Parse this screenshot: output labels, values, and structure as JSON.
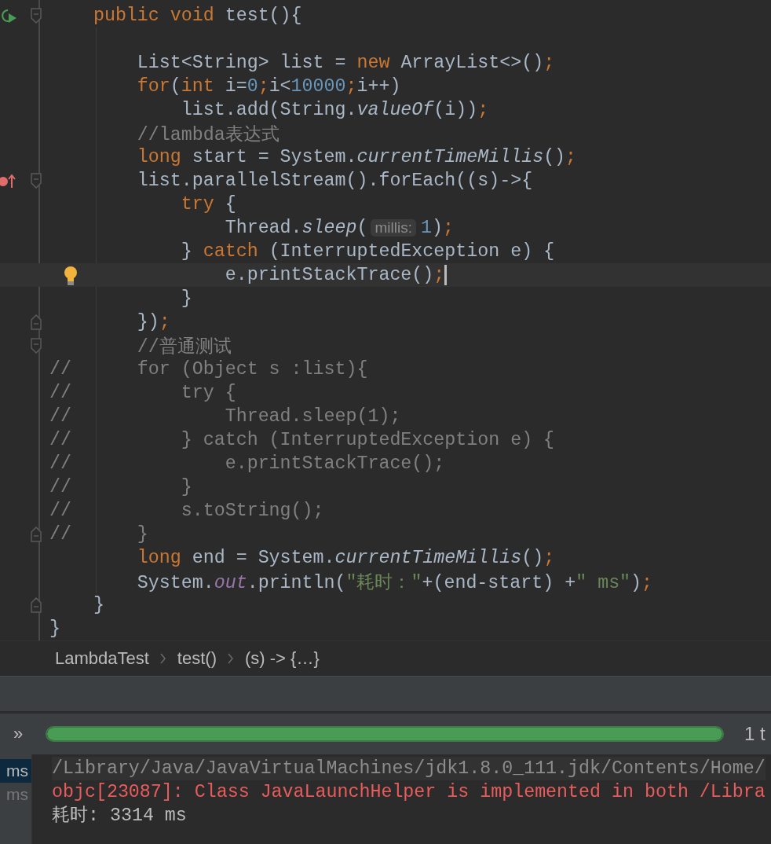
{
  "editor": {
    "lines": [
      {
        "run_marker": true,
        "fold_start": true,
        "blank_after": true,
        "tokens": [
          {
            "text": "    public void ",
            "kind": "keyword"
          },
          {
            "text": "test(){",
            "kind": "plain"
          }
        ]
      },
      {
        "tokens": [
          {
            "text": "        List<String> list = ",
            "kind": "plain"
          },
          {
            "text": "new ",
            "kind": "keyword"
          },
          {
            "text": "ArrayList<>()",
            "kind": "plain"
          },
          {
            "text": ";",
            "kind": "keyword"
          }
        ]
      },
      {
        "tokens": [
          {
            "text": "        for",
            "kind": "keyword"
          },
          {
            "text": "(",
            "kind": "plain"
          },
          {
            "text": "int ",
            "kind": "keyword"
          },
          {
            "text": "i=",
            "kind": "plain"
          },
          {
            "text": "0",
            "kind": "number"
          },
          {
            "text": ";",
            "kind": "keyword"
          },
          {
            "text": "i<",
            "kind": "plain"
          },
          {
            "text": "10000",
            "kind": "number"
          },
          {
            "text": ";",
            "kind": "keyword"
          },
          {
            "text": "i++)",
            "kind": "plain"
          }
        ]
      },
      {
        "tokens": [
          {
            "text": "            list.add(String.",
            "kind": "plain"
          },
          {
            "text": "valueOf",
            "kind": "method"
          },
          {
            "text": "(i))",
            "kind": "plain"
          },
          {
            "text": ";",
            "kind": "keyword"
          }
        ]
      },
      {
        "tokens": [
          {
            "text": "        //lambda表达式",
            "kind": "comment"
          }
        ]
      },
      {
        "tokens": [
          {
            "text": "        long ",
            "kind": "keyword"
          },
          {
            "text": "start = System.",
            "kind": "plain"
          },
          {
            "text": "currentTimeMillis",
            "kind": "method"
          },
          {
            "text": "()",
            "kind": "plain"
          },
          {
            "text": ";",
            "kind": "keyword"
          }
        ]
      },
      {
        "override_marker": true,
        "fold_start": true,
        "tokens": [
          {
            "text": "        list.parallelStream().forEach((s)->{",
            "kind": "plain"
          }
        ]
      },
      {
        "tokens": [
          {
            "text": "            try ",
            "kind": "keyword"
          },
          {
            "text": "{",
            "kind": "plain"
          }
        ]
      },
      {
        "tokens": [
          {
            "text": "                Thread.",
            "kind": "plain"
          },
          {
            "text": "sleep",
            "kind": "method"
          },
          {
            "text": "(",
            "kind": "plain"
          },
          {
            "text": "millis:",
            "kind": "hint"
          },
          {
            "text": "1",
            "kind": "number"
          },
          {
            "text": ")",
            "kind": "plain"
          },
          {
            "text": ";",
            "kind": "keyword"
          }
        ]
      },
      {
        "tokens": [
          {
            "text": "            } ",
            "kind": "plain"
          },
          {
            "text": "catch ",
            "kind": "keyword"
          },
          {
            "text": "(InterruptedException e) {",
            "kind": "plain"
          }
        ]
      },
      {
        "bulb": true,
        "current": true,
        "caret": true,
        "tokens": [
          {
            "text": "                e.printStackTrace()",
            "kind": "plain"
          },
          {
            "text": ";",
            "kind": "keyword"
          }
        ]
      },
      {
        "tokens": [
          {
            "text": "            }",
            "kind": "plain"
          }
        ]
      },
      {
        "fold_end": true,
        "tokens": [
          {
            "text": "        })",
            "kind": "plain"
          },
          {
            "text": ";",
            "kind": "keyword"
          }
        ]
      },
      {
        "fold_start": true,
        "tokens": [
          {
            "text": "        //普通测试",
            "kind": "comment"
          }
        ]
      },
      {
        "tokens": [
          {
            "text": "//      for (Object s :list){",
            "kind": "comment"
          }
        ]
      },
      {
        "tokens": [
          {
            "text": "//          try {",
            "kind": "comment"
          }
        ]
      },
      {
        "tokens": [
          {
            "text": "//              Thread.sleep(1);",
            "kind": "comment"
          }
        ]
      },
      {
        "tokens": [
          {
            "text": "//          } catch (InterruptedException e) {",
            "kind": "comment"
          }
        ]
      },
      {
        "tokens": [
          {
            "text": "//              e.printStackTrace();",
            "kind": "comment"
          }
        ]
      },
      {
        "tokens": [
          {
            "text": "//          }",
            "kind": "comment"
          }
        ]
      },
      {
        "tokens": [
          {
            "text": "//          s.toString();",
            "kind": "comment"
          }
        ]
      },
      {
        "fold_end": true,
        "tokens": [
          {
            "text": "//      }",
            "kind": "comment"
          }
        ]
      },
      {
        "tokens": [
          {
            "text": "        long ",
            "kind": "keyword"
          },
          {
            "text": "end = System.",
            "kind": "plain"
          },
          {
            "text": "currentTimeMillis",
            "kind": "method"
          },
          {
            "text": "()",
            "kind": "plain"
          },
          {
            "text": ";",
            "kind": "keyword"
          }
        ]
      },
      {
        "tokens": [
          {
            "text": "        System.",
            "kind": "plain"
          },
          {
            "text": "out",
            "kind": "field"
          },
          {
            "text": ".println(",
            "kind": "plain"
          },
          {
            "text": "\"耗时：\"",
            "kind": "string"
          },
          {
            "text": "+(end-start) +",
            "kind": "plain"
          },
          {
            "text": "\" ms\"",
            "kind": "string"
          },
          {
            "text": ")",
            "kind": "plain"
          },
          {
            "text": ";",
            "kind": "keyword"
          }
        ]
      },
      {
        "fold_end": true,
        "tokens": [
          {
            "text": "    }",
            "kind": "plain"
          }
        ]
      },
      {
        "tokens": [
          {
            "text": "}",
            "kind": "plain"
          }
        ]
      }
    ]
  },
  "breadcrumbs": [
    "LambdaTest",
    "test()",
    "(s) -> {…}"
  ],
  "run_panel": {
    "more_glyph": "»",
    "progress": {
      "level": 1.0
    },
    "summary": "1 t"
  },
  "test_times": [
    {
      "text": "ms",
      "selected": true
    },
    {
      "text": "ms",
      "selected": false
    }
  ],
  "console": [
    {
      "kind": "system",
      "text": "/Library/Java/JavaVirtualMachines/jdk1.8.0_111.jdk/Contents/Home/"
    },
    {
      "kind": "error",
      "text": "objc[23087]: Class JavaLaunchHelper is implemented in both /Libra"
    },
    {
      "kind": "output",
      "text": "耗时: 3314 ms"
    }
  ]
}
